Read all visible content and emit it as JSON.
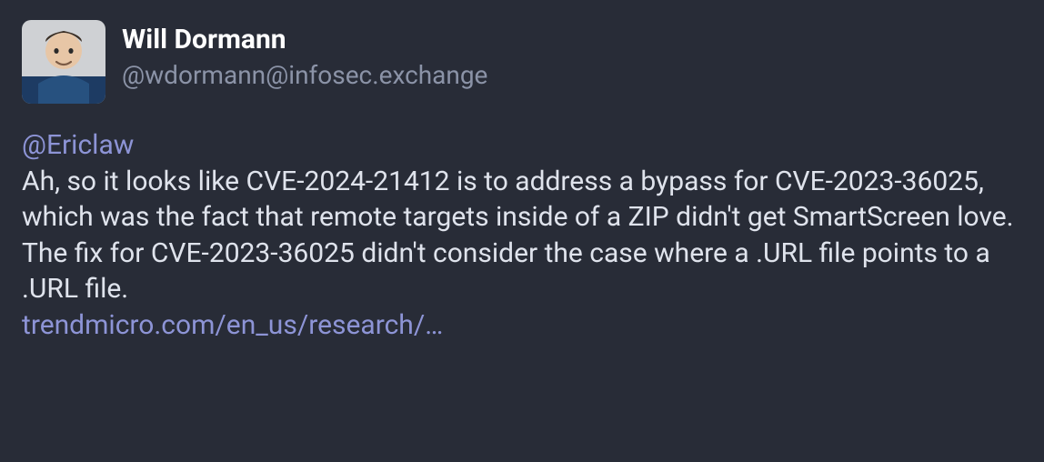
{
  "author": {
    "display_name": "Will Dormann",
    "handle": "@wdormann@infosec.exchange"
  },
  "body": {
    "mention": "@Ericlaw",
    "paragraph1": "Ah, so it looks like CVE-2024-21412 is to address a bypass for CVE-2023-36025, which was the fact that remote targets inside of a ZIP didn't get SmartScreen love.",
    "paragraph2": "The fix for CVE-2023-36025 didn't consider the case where a .URL file points to a .URL file.",
    "link_text": "trendmicro.com/en_us/research/…"
  }
}
